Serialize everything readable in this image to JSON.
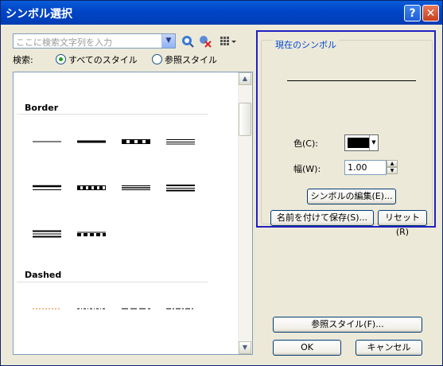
{
  "window": {
    "title": "シンボル選択",
    "help_icon": "help-icon",
    "close_icon": "close-icon"
  },
  "search": {
    "placeholder": "ここに検索文字列を入力",
    "label": "検索:",
    "options": [
      "すべてのスタイル",
      "参照スタイル"
    ],
    "selected": "すべてのスタイル"
  },
  "symbol_list": {
    "groups": [
      {
        "name": "Border",
        "count": 10
      },
      {
        "name": "Dashed",
        "count": 4
      }
    ]
  },
  "current_symbol": {
    "legend": "現在のシンボル",
    "color_label": "色(C):",
    "color_value": "#000000",
    "width_label": "幅(W):",
    "width_value": "1.00",
    "edit_button": "シンボルの編集(E)...",
    "save_as_button": "名前を付けて保存(S)...",
    "reset_button": "リセット(R)"
  },
  "footer": {
    "style_refs_button": "参照スタイル(F)...",
    "ok_button": "OK",
    "cancel_button": "キャンセル"
  },
  "colors": {
    "title_bar": "#0046c8",
    "highlight_border": "#2020c0",
    "legend_text": "#0046d5",
    "dash_orange": "#e87a1c"
  }
}
